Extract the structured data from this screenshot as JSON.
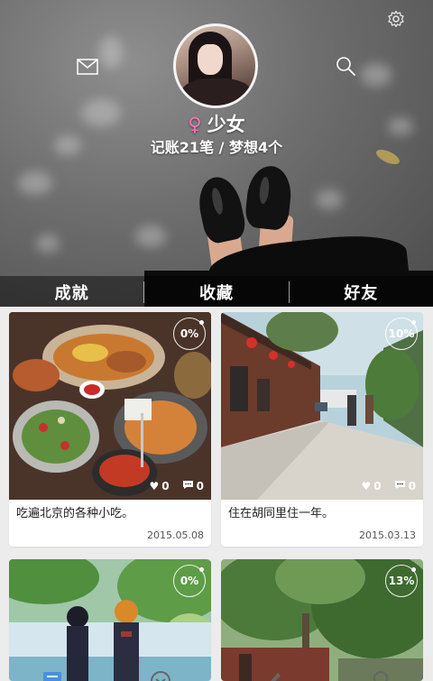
{
  "header": {
    "profile": {
      "gender_symbol": "♀",
      "name": "少女",
      "stats_text": "记账21笔 / 梦想4个"
    },
    "tabs": [
      {
        "label": "成就"
      },
      {
        "label": "收藏"
      },
      {
        "label": "好友"
      }
    ]
  },
  "cards": [
    {
      "progress": "0%",
      "likes": "0",
      "comments": "0",
      "title": "吃遍北京的各种小吃。",
      "date": "2015.05.08"
    },
    {
      "progress": "10%",
      "likes": "0",
      "comments": "0",
      "title": "住在胡同里住一年。",
      "date": "2015.03.13"
    },
    {
      "progress": "0%"
    },
    {
      "progress": "13%"
    }
  ],
  "bottom_nav": {
    "active_color": "#4a90d9",
    "items": [
      "notebook-icon",
      "compass-icon",
      "pen-icon",
      "search-icon"
    ]
  },
  "colors": {
    "gender": "#f176b9",
    "background": "#ececec"
  }
}
